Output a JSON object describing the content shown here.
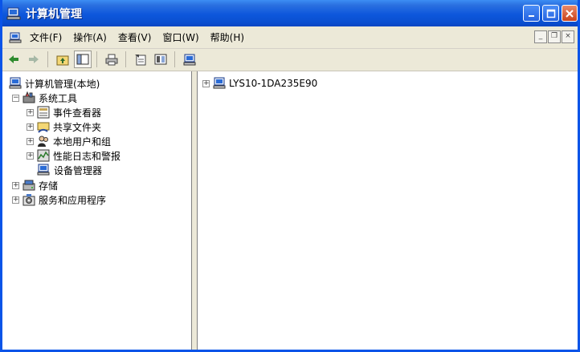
{
  "window": {
    "title": "计算机管理"
  },
  "menu": {
    "items": [
      "文件(F)",
      "操作(A)",
      "查看(V)",
      "窗口(W)",
      "帮助(H)"
    ]
  },
  "toolbar": {
    "buttons": [
      "back-icon",
      "forward-icon",
      "up-folder-icon",
      "show-hide-tree-icon",
      "print-icon",
      "properties-icon",
      "export-list-icon",
      "computer-manage-icon"
    ]
  },
  "tree": {
    "root": "计算机管理(本地)",
    "system_tools": "系统工具",
    "event_viewer": "事件查看器",
    "shared_folders": "共享文件夹",
    "local_users": "本地用户和组",
    "perf_logs": "性能日志和警报",
    "device_manager": "设备管理器",
    "storage": "存储",
    "services_apps": "服务和应用程序"
  },
  "right_pane": {
    "computer_name": "LYS10-1DA235E90"
  },
  "colors": {
    "titlebar": "#0a54e8",
    "chrome": "#ece9d8"
  }
}
